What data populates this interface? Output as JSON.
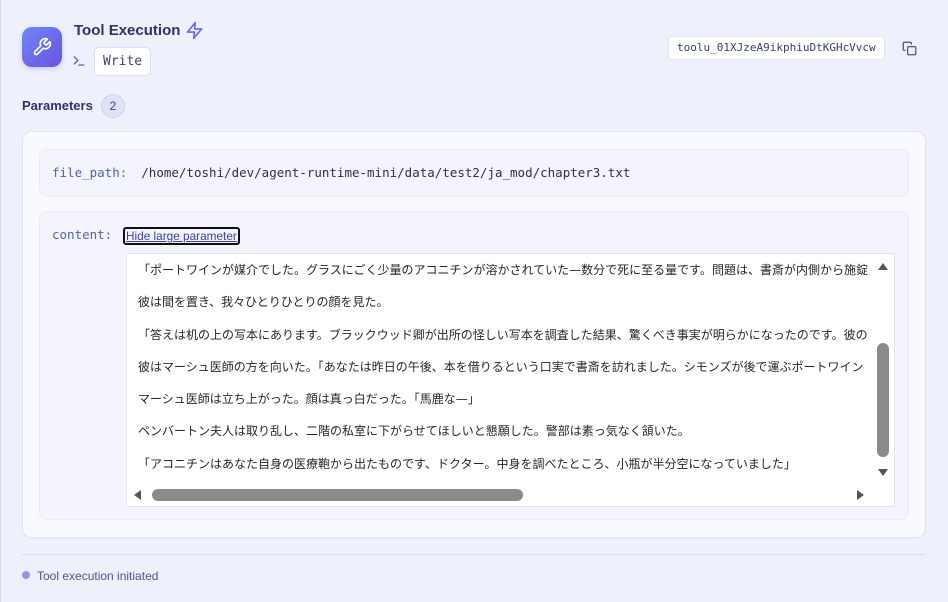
{
  "header": {
    "title": "Tool Execution",
    "tool_name": "Write",
    "tool_id": "toolu_01XJzeA9ikphiuDtKGHcVvcw",
    "icons": {
      "app": "wrench-icon",
      "title_badge": "lightning-icon",
      "tool_name": "terminal-icon",
      "copy": "copy-icon"
    }
  },
  "parameters": {
    "label": "Parameters",
    "count": 2,
    "items": [
      {
        "label": "file_path:",
        "value": "/home/toshi/dev/agent-runtime-mini/data/test2/ja_mod/chapter3.txt"
      },
      {
        "label": "content:",
        "toggle_label": "Hide large parameter",
        "lines": [
          "「ポートワインが媒介でした。グラスにごく少量のアコニチンが溶かされていた—数分で死に至る量です。問題は、書斎が内側から施錠",
          "彼は間を置き、我々ひとりひとりの顔を見た。",
          "「答えは机の上の写本にあります。ブラックウッド卿が出所の怪しい写本を調査した結果、驚くべき事実が明らかになったのです。彼の",
          "彼はマーシュ医師の方を向いた。「あなたは昨日の午後、本を借りるという口実で書斎を訪れました。シモンズが後で運ぶポートワイン",
          "マーシュ医師は立ち上がった。顔は真っ白だった。「馬鹿な—」",
          "ペンバートン夫人は取り乱し、二階の私室に下がらせてほしいと懇願した。警部は素っ気なく頷いた。",
          "「アコニチンはあなた自身の医療鞄から出たものです、ドクター。中身を調べたところ、小瓶が半分空になっていました」"
        ],
        "scroll_icons": [
          "triangle-up-icon",
          "triangle-down-icon",
          "triangle-left-icon",
          "triangle-right-icon"
        ]
      }
    ]
  },
  "footer": {
    "status": "Tool execution initiated"
  },
  "theme": {
    "page_background": "#eef0fb",
    "accent": "#6366f1",
    "app_icon_start": "#6f87f4",
    "app_icon_end": "#6b52e4",
    "heading": "#2c3370",
    "param_key": "#5060b8",
    "link": "#3a3eab",
    "status_dot": "#9b8ff0",
    "status_text": "#4b5596"
  }
}
